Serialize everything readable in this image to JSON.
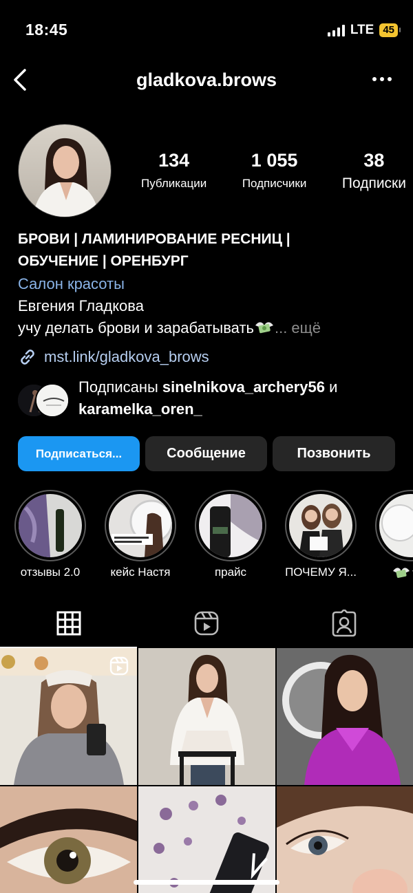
{
  "status_bar": {
    "time": "18:45",
    "network": "LTE",
    "battery": "45"
  },
  "header": {
    "username": "gladkova.brows"
  },
  "stats": [
    {
      "value": "134",
      "label": "Публикации"
    },
    {
      "value": "1 055",
      "label": "Подписчики"
    },
    {
      "value": "38",
      "label": "Подписки"
    }
  ],
  "bio": {
    "name_line1": "БРОВИ | ЛАМИНИРОВАНИЕ РЕСНИЦ |",
    "name_line2": "ОБУЧЕНИЕ | ОРЕНБУРГ",
    "category": "Салон красоты",
    "full_name": "Евгения Гладкова",
    "text": "учу делать брови и зарабатывать",
    "more": "... ещё",
    "link": "mst.link/gladkova_brows"
  },
  "followed_by": {
    "prefix": "Подписаны ",
    "user1": "sinelnikova_archery56",
    "joiner": " и",
    "user2": "karamelka_oren_"
  },
  "buttons": {
    "follow": "Подписаться...",
    "message": "Сообщение",
    "call": "Позвонить"
  },
  "highlights": [
    {
      "caption": "отзывы 2.0"
    },
    {
      "caption": "кейс Настя"
    },
    {
      "caption": "прайс"
    },
    {
      "caption": "ПОЧЕМУ Я..."
    },
    {
      "caption": ""
    }
  ],
  "tabs": [
    "grid-icon",
    "reels-icon",
    "tagged-icon"
  ],
  "colors": {
    "accent": "#1b97f2",
    "link": "#8ab4e8",
    "button_bg": "#262626"
  }
}
